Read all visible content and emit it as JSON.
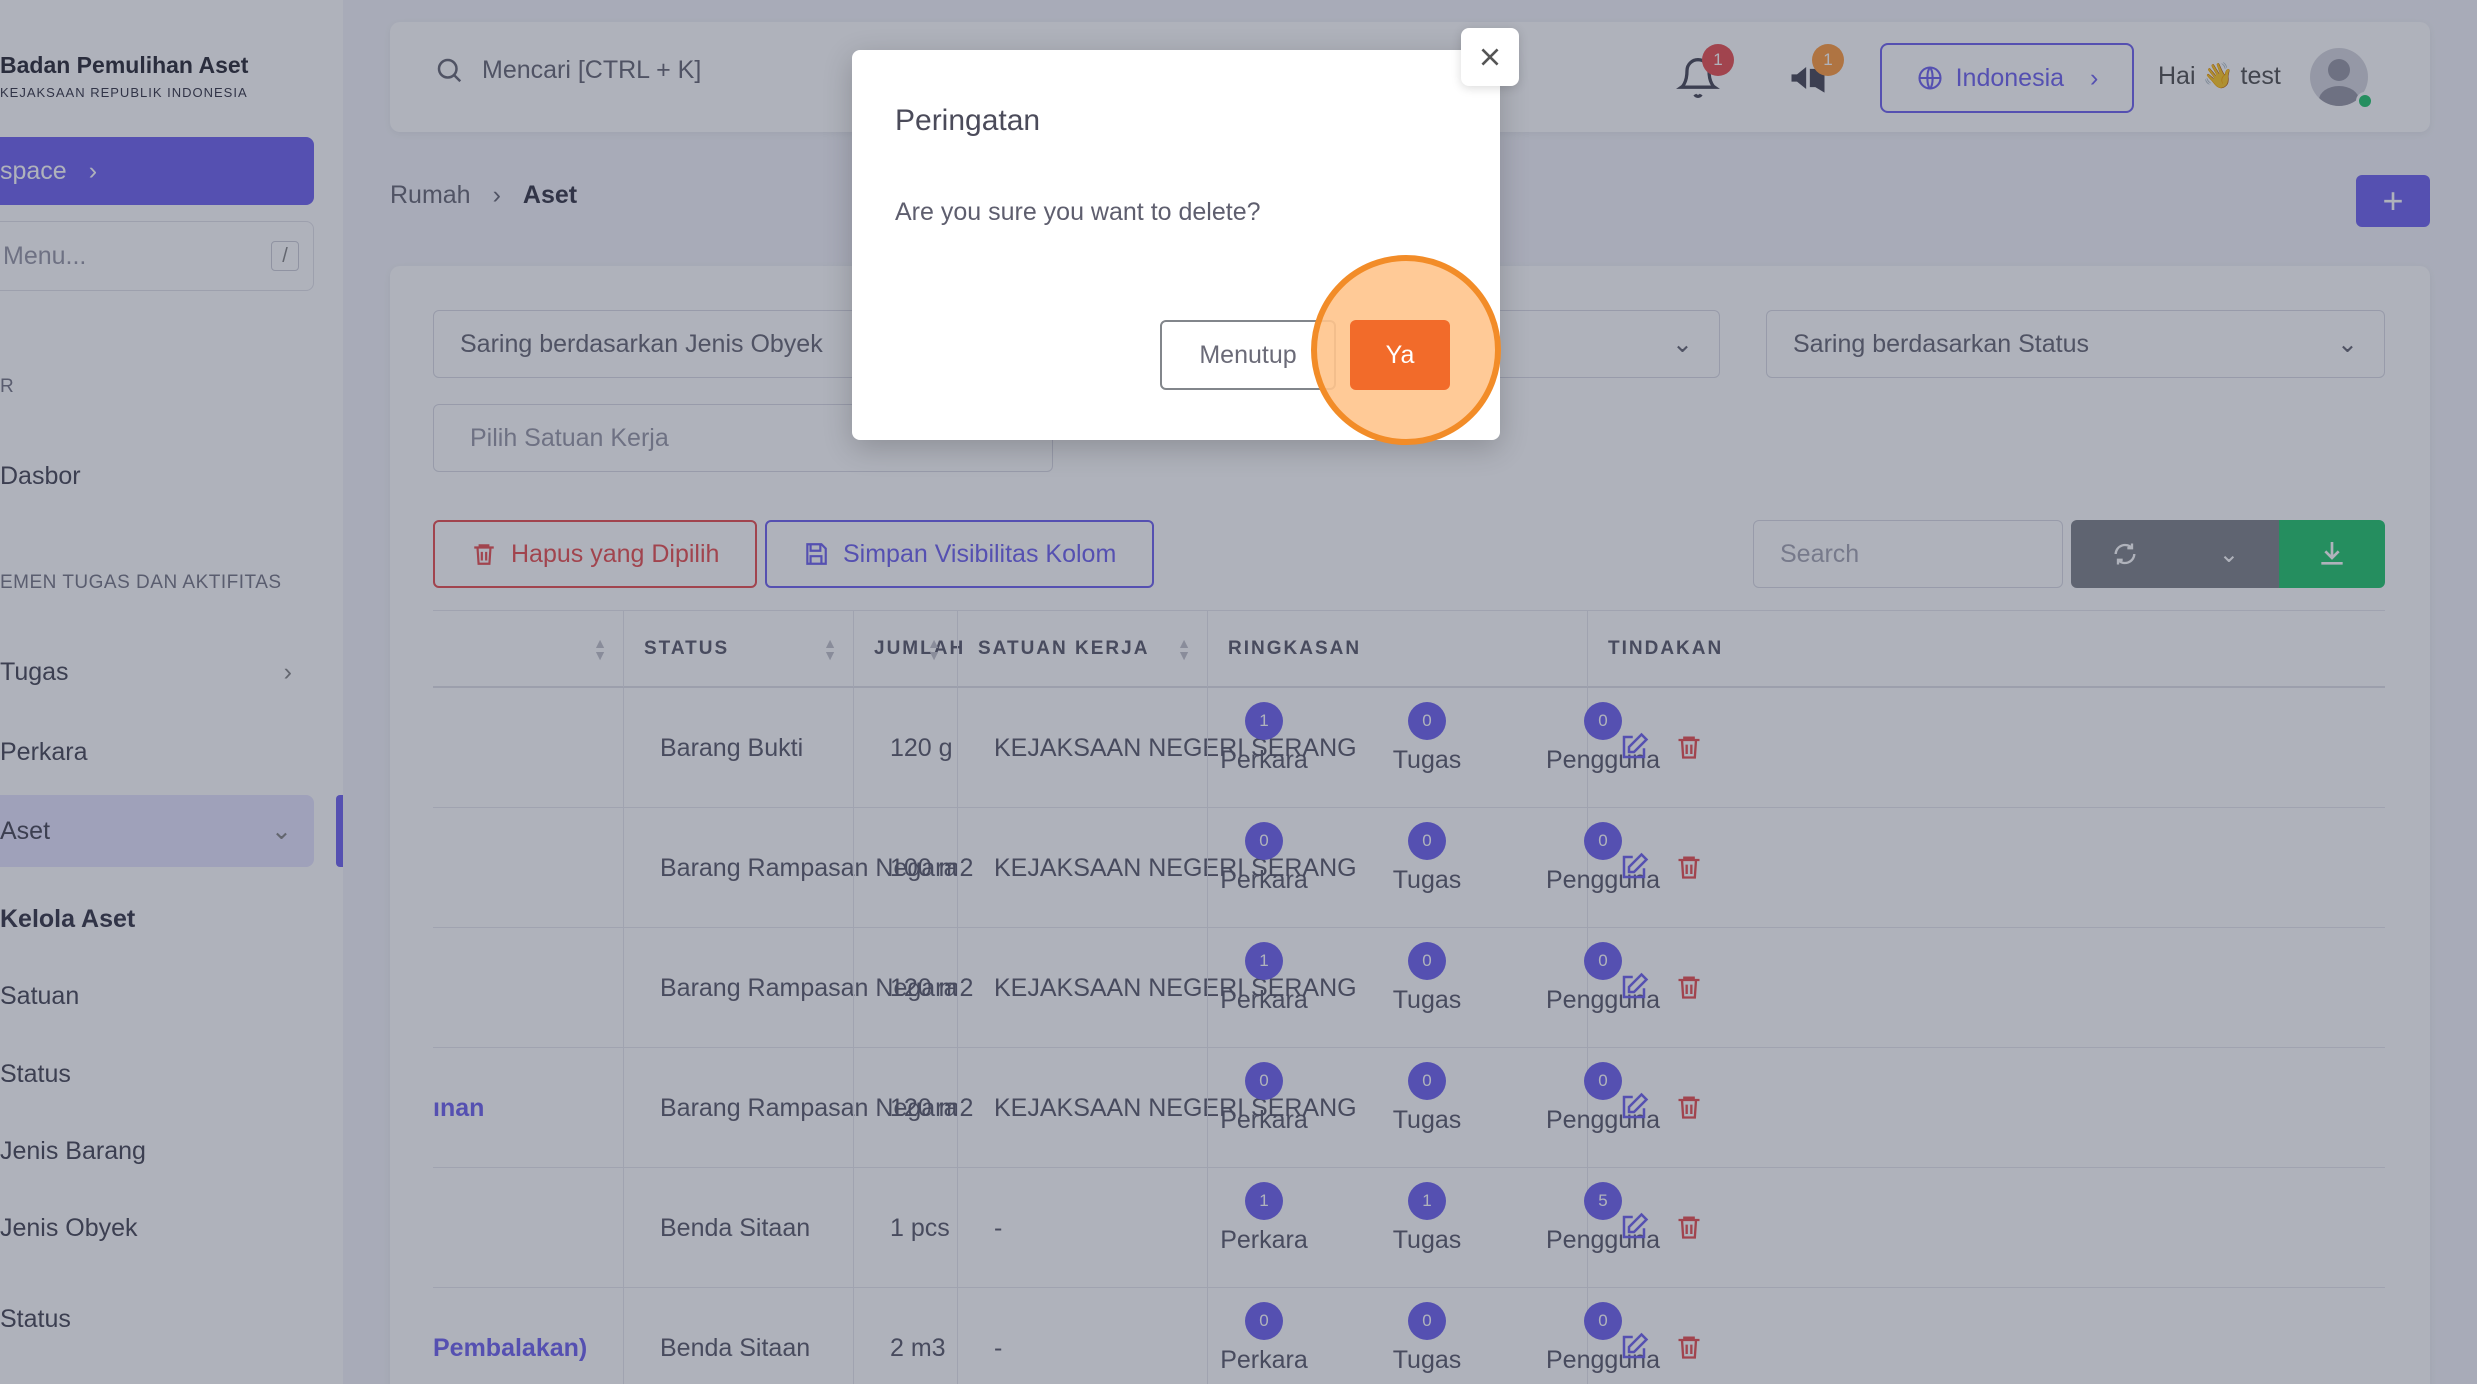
{
  "brand": {
    "title": "Badan Pemulihan Aset",
    "subtitle": "KEJAKSAAN REPUBLIK INDONESIA"
  },
  "sidebar": {
    "workspace_label": "space",
    "menu_search_placeholder": "Menu...",
    "menu_search_shortcut": "/",
    "section1": "R",
    "section2": "EMEN TUGAS DAN AKTIFITAS",
    "items": [
      {
        "label": "Dasbor"
      },
      {
        "label": "Tugas"
      },
      {
        "label": "Perkara"
      },
      {
        "label": "Aset"
      },
      {
        "label": "Kelola Aset"
      },
      {
        "label": "Satuan"
      },
      {
        "label": "Status"
      },
      {
        "label": "Jenis Barang"
      },
      {
        "label": "Jenis Obyek"
      },
      {
        "label": "Status"
      }
    ]
  },
  "header": {
    "search_placeholder": "Mencari [CTRL + K]",
    "notif_count": "1",
    "announce_count": "1",
    "language": "Indonesia",
    "greeting": "Hai 👋 test"
  },
  "breadcrumb": {
    "home": "Rumah",
    "current": "Aset"
  },
  "add_button": "+",
  "filters": {
    "jenis_obyek": "Saring berdasarkan Jenis Obyek",
    "status": "Saring berdasarkan Status",
    "satuan_kerja": "Pilih Satuan Kerja"
  },
  "toolbar": {
    "delete_selected": "Hapus yang Dipilih",
    "save_columns": "Simpan Visibilitas Kolom",
    "search_placeholder": "Search"
  },
  "table": {
    "columns": [
      "STATUS",
      "JUMLAH",
      "SATUAN KERJA",
      "RINGKASAN",
      "TINDAKAN"
    ],
    "summary_labels": [
      "Perkara",
      "Tugas",
      "Pengguna"
    ],
    "rows": [
      {
        "name": "",
        "status": "Barang Bukti",
        "jumlah": "120 g",
        "satuan": "KEJAKSAAN NEGERI SERANG",
        "perkara": "1",
        "tugas": "0",
        "pengguna": "0"
      },
      {
        "name": "",
        "status": "Barang Rampasan Negara",
        "jumlah": "100 m2",
        "satuan": "KEJAKSAAN NEGERI SERANG",
        "perkara": "0",
        "tugas": "0",
        "pengguna": "0"
      },
      {
        "name": "",
        "status": "Barang Rampasan Negara",
        "jumlah": "120 m2",
        "satuan": "KEJAKSAAN NEGERI SERANG",
        "perkara": "1",
        "tugas": "0",
        "pengguna": "0"
      },
      {
        "name": "ınan",
        "status": "Barang Rampasan Negara",
        "jumlah": "120 m2",
        "satuan": "KEJAKSAAN NEGERI SERANG",
        "perkara": "0",
        "tugas": "0",
        "pengguna": "0"
      },
      {
        "name": "",
        "status": "Benda Sitaan",
        "jumlah": "1 pcs",
        "satuan": "-",
        "perkara": "1",
        "tugas": "1",
        "pengguna": "5"
      },
      {
        "name": "Pembalakan)",
        "status": "Benda Sitaan",
        "jumlah": "2 m3",
        "satuan": "-",
        "perkara": "0",
        "tugas": "0",
        "pengguna": "0"
      }
    ]
  },
  "modal": {
    "title": "Peringatan",
    "message": "Are you sure you want to delete?",
    "cancel_label": "Menutup",
    "confirm_label": "Ya"
  },
  "colors": {
    "primary": "#7367f0",
    "danger": "#ea5455",
    "success": "#28c76f",
    "confirm": "#f26b2a"
  }
}
